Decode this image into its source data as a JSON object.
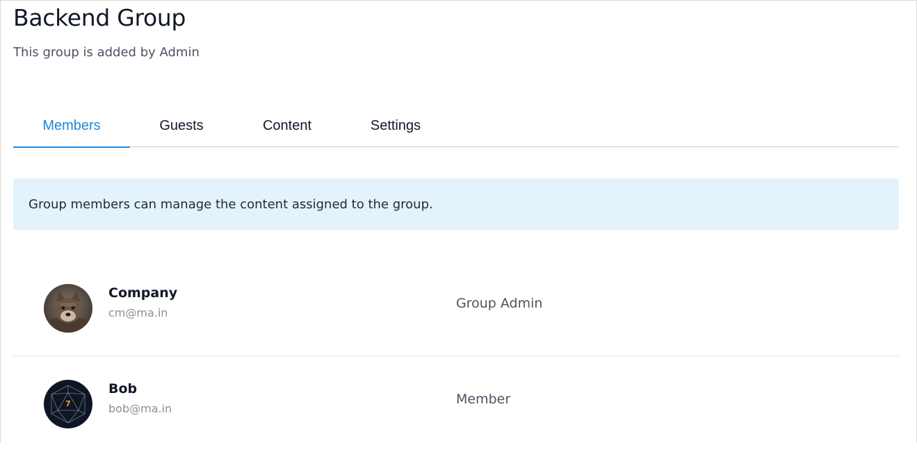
{
  "group": {
    "title": "Backend Group",
    "subtitle": "This group is added by Admin"
  },
  "tabs": [
    {
      "label": "Members",
      "active": true
    },
    {
      "label": "Guests",
      "active": false
    },
    {
      "label": "Content",
      "active": false
    },
    {
      "label": "Settings",
      "active": false
    }
  ],
  "info": {
    "text": "Group members can manage the content assigned to the group."
  },
  "members": [
    {
      "name": "Company",
      "email": "cm@ma.in",
      "role": "Group Admin",
      "avatar": "fox-photo-avatar"
    },
    {
      "name": "Bob",
      "email": "bob@ma.in",
      "role": "Member",
      "avatar": "d20-dice-avatar",
      "avatar_glyph": "7"
    }
  ],
  "colors": {
    "accent": "#1e88d6",
    "info_bg": "#e3f2fb"
  }
}
